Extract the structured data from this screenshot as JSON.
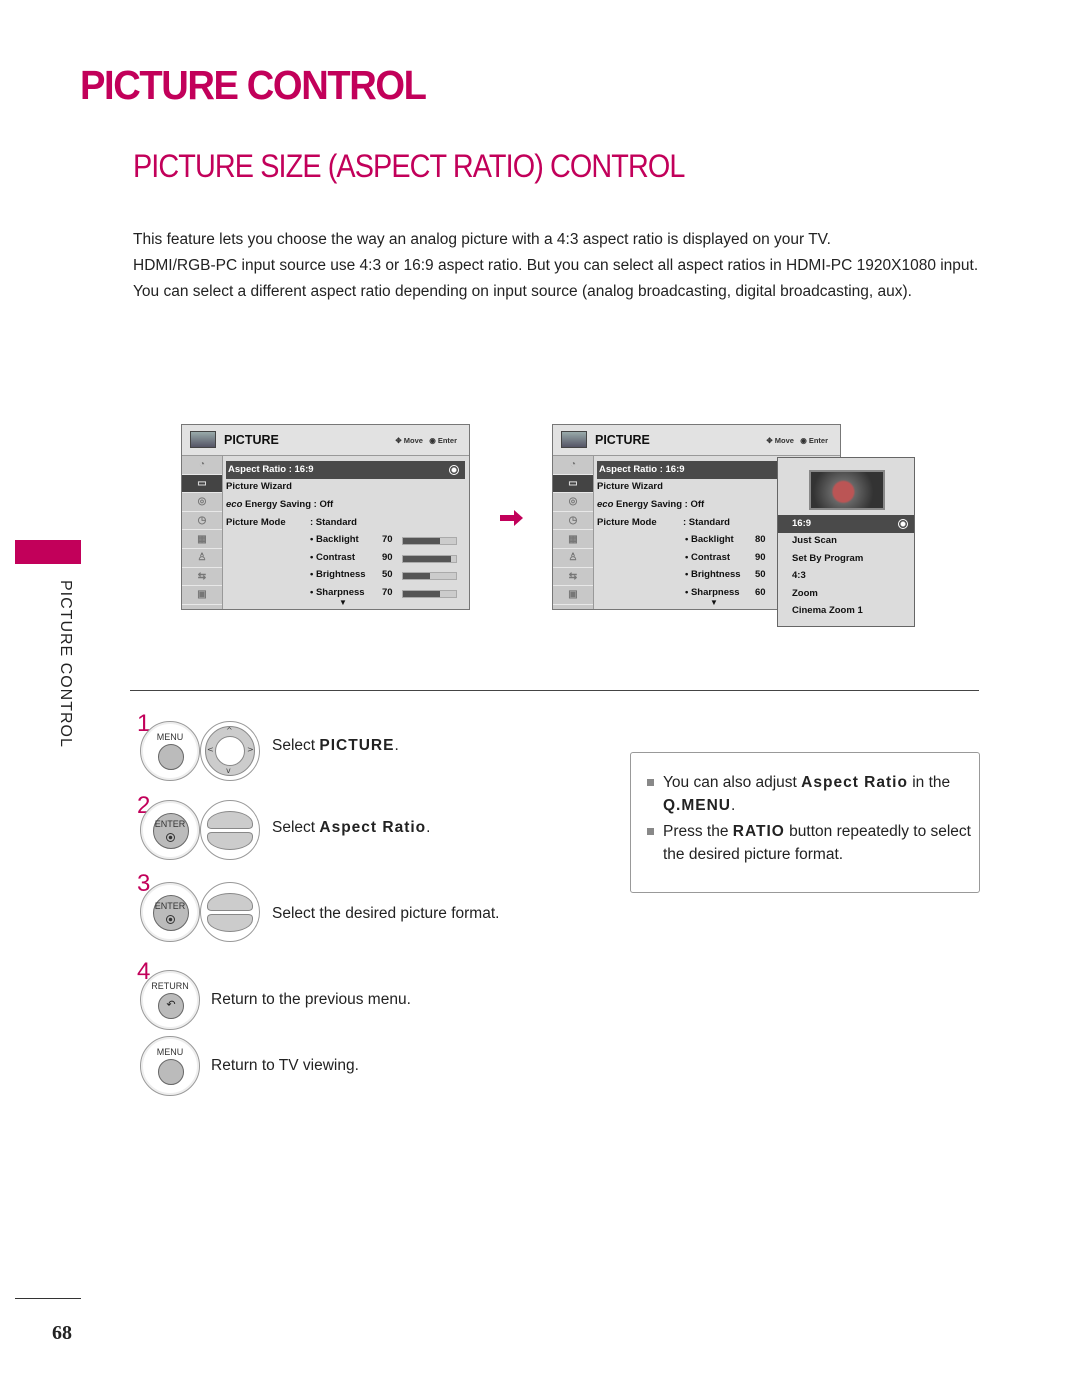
{
  "page": {
    "title": "PICTURE CONTROL",
    "subtitle": "PICTURE SIZE (ASPECT RATIO) CONTROL",
    "side_label": "PICTURE CONTROL",
    "page_number": "68",
    "accent_color": "#c2005a"
  },
  "intro": [
    "This feature lets you choose the way an analog picture with a 4:3 aspect ratio is displayed on your TV.",
    "HDMI/RGB-PC input source use 4:3 or 16:9 aspect ratio. But you can select all aspect ratios in HDMI-PC 1920X1080 input.",
    "You can select a different aspect ratio depending on input source (analog broadcasting, digital broadcasting, aux)."
  ],
  "osd_left": {
    "title": "PICTURE",
    "move_label": "Move",
    "enter_label": "Enter",
    "side_icons": [
      "satellite-icon",
      "picture-icon",
      "audio-icon",
      "time-icon",
      "option-icon",
      "lock-icon",
      "input-icon",
      "usb-icon"
    ],
    "aspect_ratio": "Aspect Ratio   : 16:9",
    "picture_wizard": "Picture Wizard",
    "energy_saving": "Energy Saving : Off",
    "picture_mode_label": "Picture Mode",
    "picture_mode_value": ": Standard",
    "settings": [
      {
        "label": "• Backlight",
        "value": "70",
        "fraction": 0.7
      },
      {
        "label": "• Contrast",
        "value": "90",
        "fraction": 0.9
      },
      {
        "label": "• Brightness",
        "value": "50",
        "fraction": 0.5
      },
      {
        "label": "• Sharpness",
        "value": "70",
        "fraction": 0.7
      }
    ],
    "more_icon": "▼"
  },
  "osd_right": {
    "title": "PICTURE",
    "move_label": "Move",
    "enter_label": "Enter",
    "aspect_ratio": "Aspect Ratio   : 16:9",
    "picture_wizard": "Picture Wizard",
    "energy_saving": "Energy Saving : Off",
    "picture_mode_label": "Picture Mode",
    "picture_mode_value": ": Standard",
    "settings": [
      {
        "label": "• Backlight",
        "value": "80"
      },
      {
        "label": "• Contrast",
        "value": "90"
      },
      {
        "label": "• Brightness",
        "value": "50"
      },
      {
        "label": "• Sharpness",
        "value": "60"
      }
    ],
    "more_icon": "▼",
    "popup_options": [
      "16:9",
      "Just Scan",
      "Set By Program",
      "4:3",
      "Zoom",
      "Cinema Zoom 1"
    ],
    "popup_selected": "16:9"
  },
  "steps": [
    {
      "num": "1",
      "button": "MENU",
      "text_pre": "Select ",
      "text_bold": "PICTURE",
      "text_post": "."
    },
    {
      "num": "2",
      "button": "ENTER",
      "text_pre": "Select ",
      "text_bold": "Aspect Ratio",
      "text_post": "."
    },
    {
      "num": "3",
      "button": "ENTER",
      "text_pre": "Select the desired picture format.",
      "text_bold": "",
      "text_post": ""
    },
    {
      "num": "4",
      "button": "RETURN",
      "text_pre": "Return to the previous menu.",
      "text_bold": "",
      "text_post": ""
    },
    {
      "num": "",
      "button": "MENU",
      "text_pre": "Return to TV viewing.",
      "text_bold": "",
      "text_post": ""
    }
  ],
  "notes": {
    "n1_pre": "You can also adjust ",
    "n1_bold": "Aspect Ratio",
    "n1_mid": " in the ",
    "n1_bold2": "Q.MENU",
    "n1_post": ".",
    "n2_pre": "Press the ",
    "n2_bold": "RATIO",
    "n2_post": " button repeatedly to select the desired picture format."
  }
}
